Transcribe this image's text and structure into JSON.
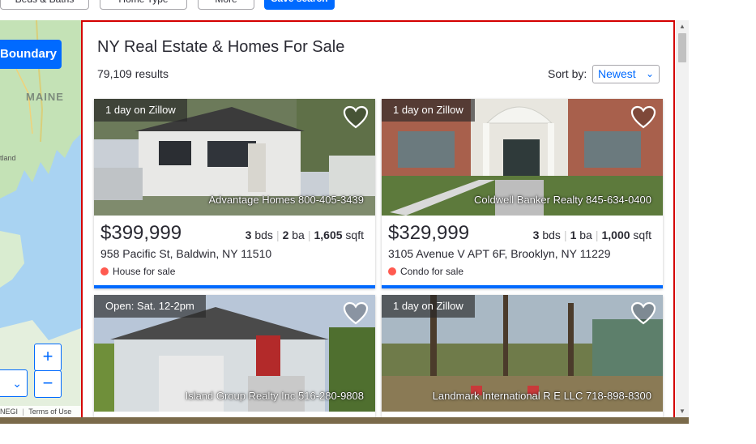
{
  "filters": {
    "beds_baths": "Beds & Baths",
    "home_type": "Home Type",
    "more": "More",
    "save_search": "Save search"
  },
  "map": {
    "boundary_label": "Boundary",
    "state_label": "MAINE",
    "town_label": "tland",
    "zoom_in": "+",
    "zoom_out": "−",
    "layers_chevron": "⌄",
    "credits_left": "NEGI",
    "terms": "Terms of Use"
  },
  "panel": {
    "title": "NY Real Estate & Homes For Sale",
    "result_count": "79,109 results",
    "sort_label": "Sort by:",
    "sort_value": "Newest"
  },
  "listings": [
    {
      "badge": "1 day on Zillow",
      "brokerage": "Advantage Homes 800-405-3439",
      "price": "$399,999",
      "beds": "3",
      "beds_unit": "bds",
      "baths": "2",
      "baths_unit": "ba",
      "sqft": "1,605",
      "sqft_unit": "sqft",
      "address": "958 Pacific St, Baldwin, NY 11510",
      "status": "House for sale"
    },
    {
      "badge": "1 day on Zillow",
      "brokerage": "Coldwell Banker Realty 845-634-0400",
      "price": "$329,999",
      "beds": "3",
      "beds_unit": "bds",
      "baths": "1",
      "baths_unit": "ba",
      "sqft": "1,000",
      "sqft_unit": "sqft",
      "address": "3105 Avenue V APT 6F, Brooklyn, NY 11229",
      "status": "Condo for sale"
    },
    {
      "badge": "Open: Sat. 12-2pm",
      "brokerage": "Island Group Realty Inc 516-280-9808"
    },
    {
      "badge": "1 day on Zillow",
      "brokerage": "Landmark International R E LLC 718-898-8300"
    }
  ],
  "colors": {
    "accent": "#006aff",
    "status_dot": "#ff5a50",
    "panel_border": "#d40000"
  }
}
